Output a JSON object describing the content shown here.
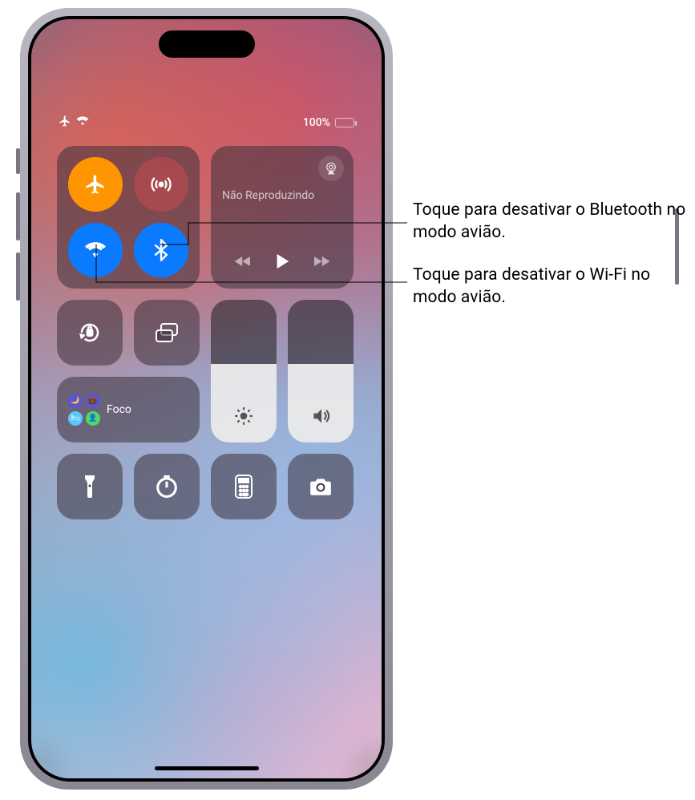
{
  "status": {
    "battery_text": "100%"
  },
  "music": {
    "title": "Não Reproduzindo"
  },
  "focus": {
    "label": "Foco"
  },
  "colors": {
    "airplane_on": "#ff9500",
    "wifi_on": "#0a7aff",
    "bluetooth_on": "#0a7aff"
  },
  "sliders": {
    "brightness_pct": 55,
    "volume_pct": 55
  },
  "callouts": {
    "bluetooth": "Toque para desativar o Bluetooth no modo avião.",
    "wifi": "Toque para desativar o Wi‑Fi no modo avião."
  }
}
